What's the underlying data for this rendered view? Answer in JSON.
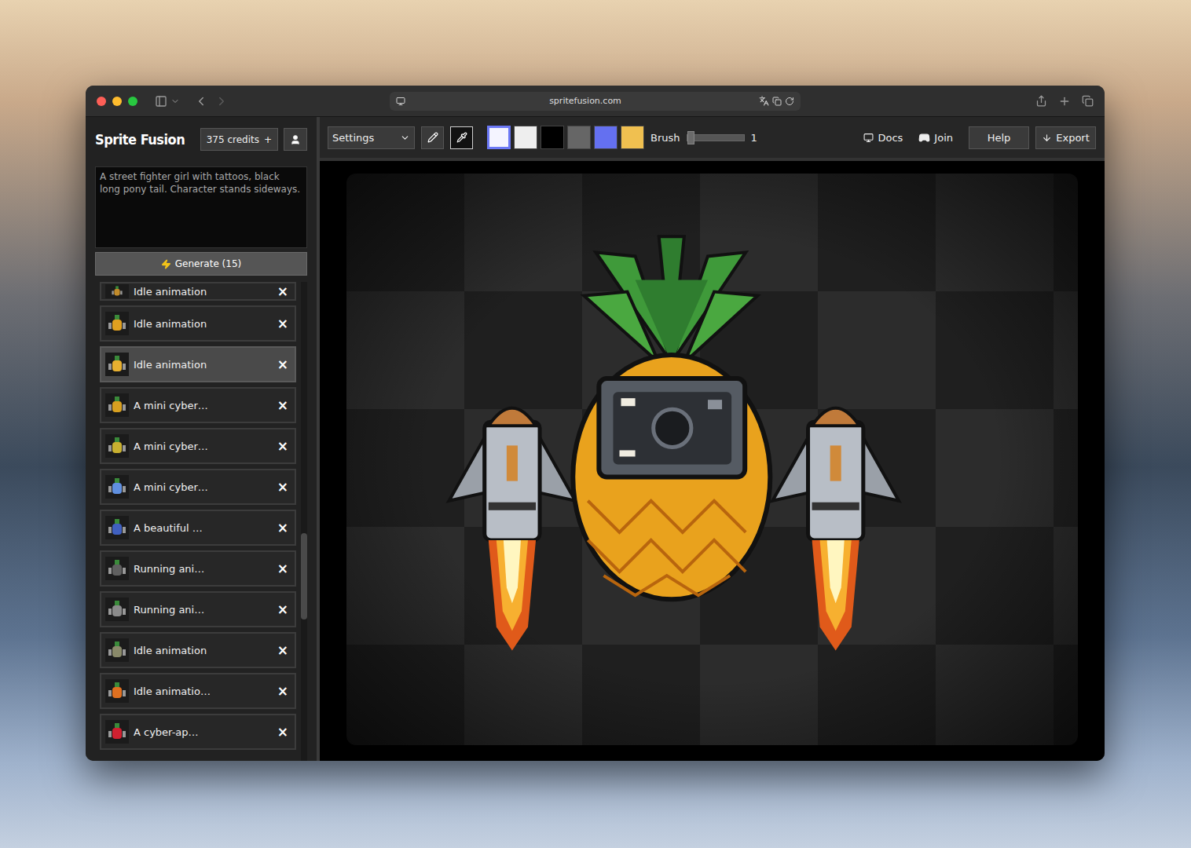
{
  "window": {
    "url": "spritefusion.com"
  },
  "app": {
    "name": "Sprite Fusion",
    "credits": "375 credits",
    "credits_add": "+"
  },
  "prompt": {
    "text": "A street fighter girl with tattoos, black long pony tail. Character stands sideways."
  },
  "generate": {
    "label": "Generate (15)"
  },
  "close_glyph": "×",
  "history": [
    {
      "label": "Idle animation",
      "selected": false,
      "partial": true,
      "color": "#c08a2a"
    },
    {
      "label": "Idle animation",
      "selected": false,
      "partial": false,
      "color": "#e0a020"
    },
    {
      "label": "Idle animation",
      "selected": true,
      "partial": false,
      "color": "#e8b030"
    },
    {
      "label": "A mini cyber…",
      "selected": false,
      "partial": false,
      "color": "#d8a020"
    },
    {
      "label": "A mini cyber…",
      "selected": false,
      "partial": false,
      "color": "#c8b030"
    },
    {
      "label": "A mini cyber…",
      "selected": false,
      "partial": false,
      "color": "#6090e0"
    },
    {
      "label": "A beautiful …",
      "selected": false,
      "partial": false,
      "color": "#4060c0"
    },
    {
      "label": "Running ani…",
      "selected": false,
      "partial": false,
      "color": "#606060"
    },
    {
      "label": "Running ani…",
      "selected": false,
      "partial": false,
      "color": "#8a8a8a"
    },
    {
      "label": "Idle animation",
      "selected": false,
      "partial": false,
      "color": "#8a8a6a"
    },
    {
      "label": "Idle animatio…",
      "selected": false,
      "partial": false,
      "color": "#e07020"
    },
    {
      "label": "A cyber-ap…",
      "selected": false,
      "partial": false,
      "color": "#d02030"
    }
  ],
  "toolbar": {
    "settings": "Settings",
    "tools": [
      {
        "kind": "pencil",
        "selected": false
      },
      {
        "kind": "eyedropper",
        "selected": true
      }
    ],
    "swatches": [
      {
        "color": "#f4f4ff",
        "selected": true
      },
      {
        "color": "#eeeeee",
        "selected": false
      },
      {
        "color": "#000000",
        "selected": false
      },
      {
        "color": "#666666",
        "selected": false
      },
      {
        "color": "#6470f0",
        "selected": false
      },
      {
        "color": "#f0c050",
        "selected": false
      }
    ],
    "brush": {
      "label": "Brush",
      "level": 0,
      "reading": "1"
    },
    "links": [
      {
        "kind": "docs",
        "label": "Docs"
      },
      {
        "kind": "discord",
        "label": "Join"
      }
    ],
    "buttons": [
      {
        "kind": "help",
        "label": "Help"
      },
      {
        "kind": "export",
        "label": "Export"
      }
    ]
  }
}
